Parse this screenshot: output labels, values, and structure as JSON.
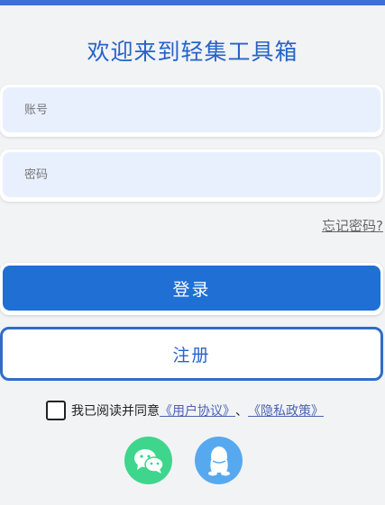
{
  "title": "欢迎来到轻集工具箱",
  "account_field": {
    "placeholder": "账号"
  },
  "password_field": {
    "placeholder": "密码"
  },
  "forgot_label": "忘记密码?",
  "login_label": "登录",
  "register_label": "注册",
  "agreement": {
    "prefix": "我已阅读并同意",
    "user_agreement": "《用户协议》",
    "separator": "、",
    "privacy_policy": "《隐私政策》"
  },
  "icons": {
    "wechat": "wechat-icon",
    "qq": "qq-icon"
  },
  "colors": {
    "accent": "#1f6fd4",
    "title": "#2563c9",
    "input_bg": "#e8f0fe",
    "wechat": "#3dd68c",
    "qq": "#56a9ef"
  }
}
